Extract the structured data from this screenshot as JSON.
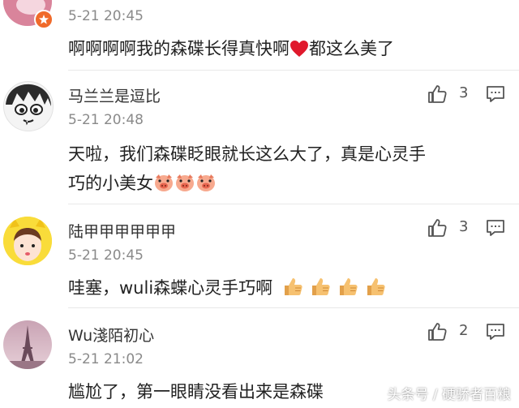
{
  "comments": [
    {
      "username": "",
      "time": "5-21 20:45",
      "text": "啊啊啊啊我的森碟长得真快啊",
      "text_after": "都这么美了",
      "likes": "",
      "avatar": "avatar-partial"
    },
    {
      "username": "马兰兰是逗比",
      "time": "5-21 20:48",
      "text_line1": "天啦，我们森碟眨眼就长这么大了，真是心灵手",
      "text_line2": "巧的小美女",
      "likes": "3",
      "avatar": "cartoon-face"
    },
    {
      "username": "陆甲甲甲甲甲甲",
      "time": "5-21 20:45",
      "text": "哇塞，wuli森蝶心灵手巧啊",
      "likes": "3",
      "avatar": "yellow-hood-girl"
    },
    {
      "username": "Wu淺陌初心",
      "time": "5-21 21:02",
      "text": "尴尬了，第一眼睛没看出来是森碟",
      "likes": "2",
      "avatar": "eiffel-tower"
    }
  ],
  "icons": {
    "like": "thumbs-up-icon",
    "reply": "comment-icon",
    "heart": "red-heart-emoji",
    "pig": "pig-face-emoji",
    "thumb": "thumbs-up-emoji"
  },
  "watermark": "头条号 / 硬骄者百粮",
  "colors": {
    "text": "#222222",
    "meta": "#8a8a8a",
    "heart": "#e0192c"
  }
}
